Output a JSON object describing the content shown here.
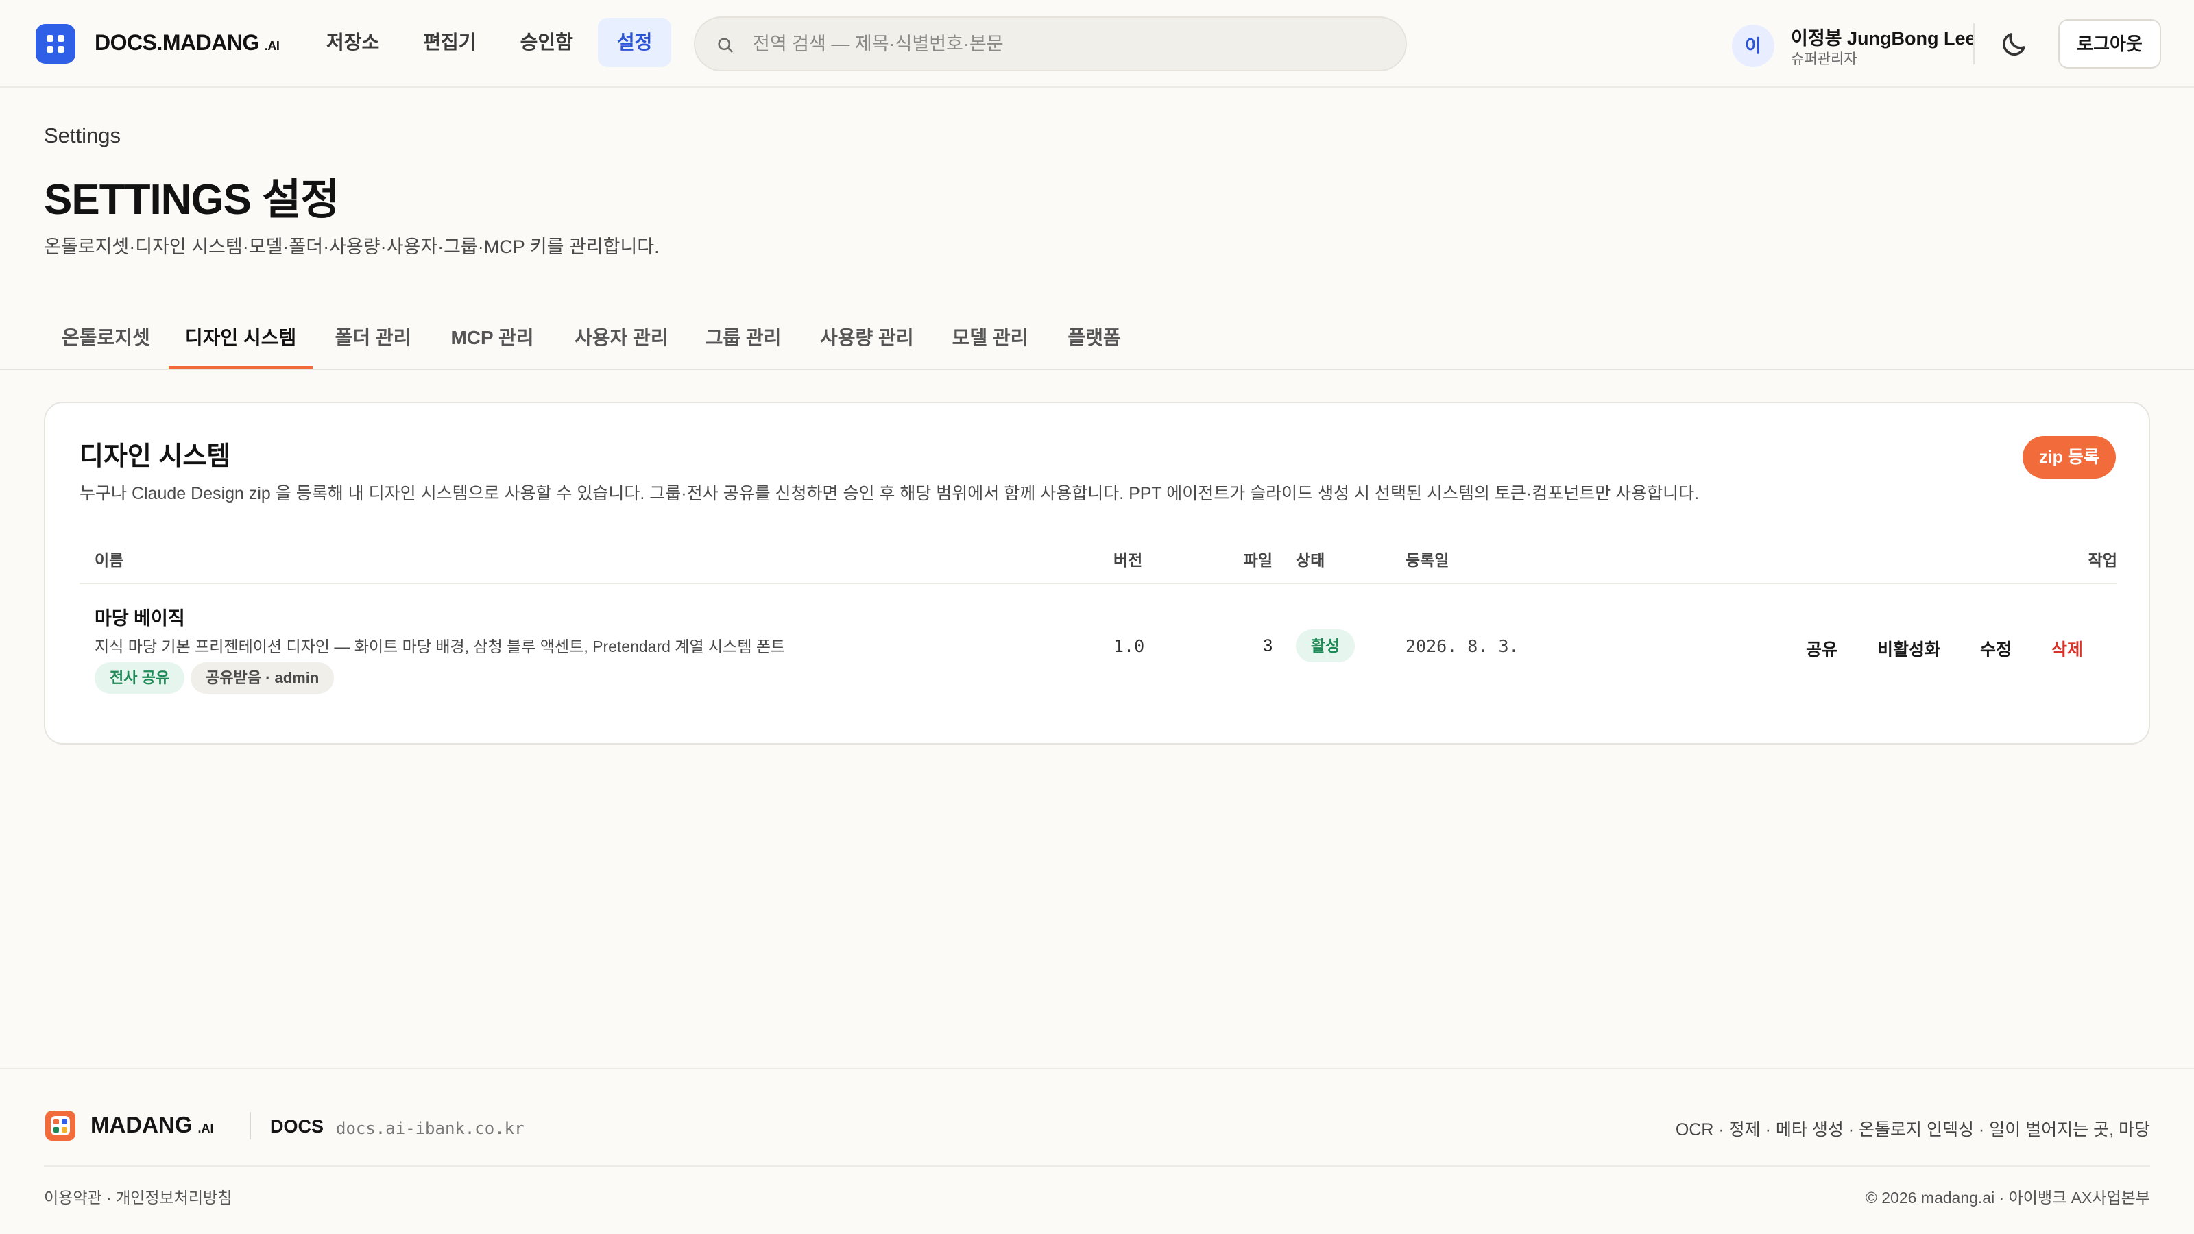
{
  "header": {
    "brand": "DOCS.MADANG",
    "brand_suffix": ".AI",
    "nav": [
      {
        "label": "저장소"
      },
      {
        "label": "편집기"
      },
      {
        "label": "승인함"
      },
      {
        "label": "설정",
        "active": true
      }
    ],
    "search_placeholder": "전역 검색 — 제목·식별번호·본문",
    "user": {
      "avatar_initial": "이",
      "name": "이정봉 JungBong Lee",
      "role": "슈퍼관리자"
    },
    "logout_label": "로그아웃"
  },
  "page": {
    "breadcrumb": "Settings",
    "title": "SETTINGS 설정",
    "description": "온톨로지셋·디자인 시스템·모델·폴더·사용량·사용자·그룹·MCP 키를 관리합니다."
  },
  "tabs": [
    {
      "label": "온톨로지셋"
    },
    {
      "label": "디자인 시스템",
      "active": true
    },
    {
      "label": "폴더 관리"
    },
    {
      "label": "MCP 관리"
    },
    {
      "label": "사용자 관리"
    },
    {
      "label": "그룹 관리"
    },
    {
      "label": "사용량 관리"
    },
    {
      "label": "모델 관리"
    },
    {
      "label": "플랫폼"
    }
  ],
  "design_system": {
    "title": "디자인 시스템",
    "description": "누구나 Claude Design zip 을 등록해 내 디자인 시스템으로 사용할 수 있습니다. 그룹·전사 공유를 신청하면 승인 후 해당 범위에서 함께 사용합니다. PPT 에이전트가 슬라이드 생성 시 선택된 시스템의 토큰·컴포넌트만 사용합니다.",
    "zip_button": "zip 등록",
    "columns": {
      "name": "이름",
      "version": "버전",
      "files": "파일",
      "status": "상태",
      "registered": "등록일",
      "actions": "작업"
    },
    "rows": [
      {
        "name": "마당 베이직",
        "description": "지식 마당 기본 프리젠테이션 디자인 — 화이트 마당 배경, 삼청 블루 액센트, Pretendard 계열 시스템 폰트",
        "badges": [
          "전사 공유",
          "공유받음 · admin"
        ],
        "version": "1.0",
        "files": "3",
        "status": "활성",
        "registered": "2026. 8. 3.",
        "actions": [
          "공유",
          "비활성화",
          "수정",
          "삭제"
        ]
      }
    ]
  },
  "footer": {
    "brand": "MADANG",
    "brand_suffix": ".AI",
    "docs_label": "DOCS",
    "domain": "docs.ai-ibank.co.kr",
    "tagline": "OCR · 정제 · 메타 생성 · 온톨로지 인덱싱  ·  일이 벌어지는 곳, 마당",
    "links": "이용약관  ·  개인정보처리방침",
    "copyright": "© 2026 madang.ai · 아이뱅크 AX사업본부"
  },
  "colors": {
    "accent": "#f26b3a",
    "brand_blue": "#2f5fe6",
    "active_green": "#1f8a57",
    "danger": "#d6342a"
  }
}
